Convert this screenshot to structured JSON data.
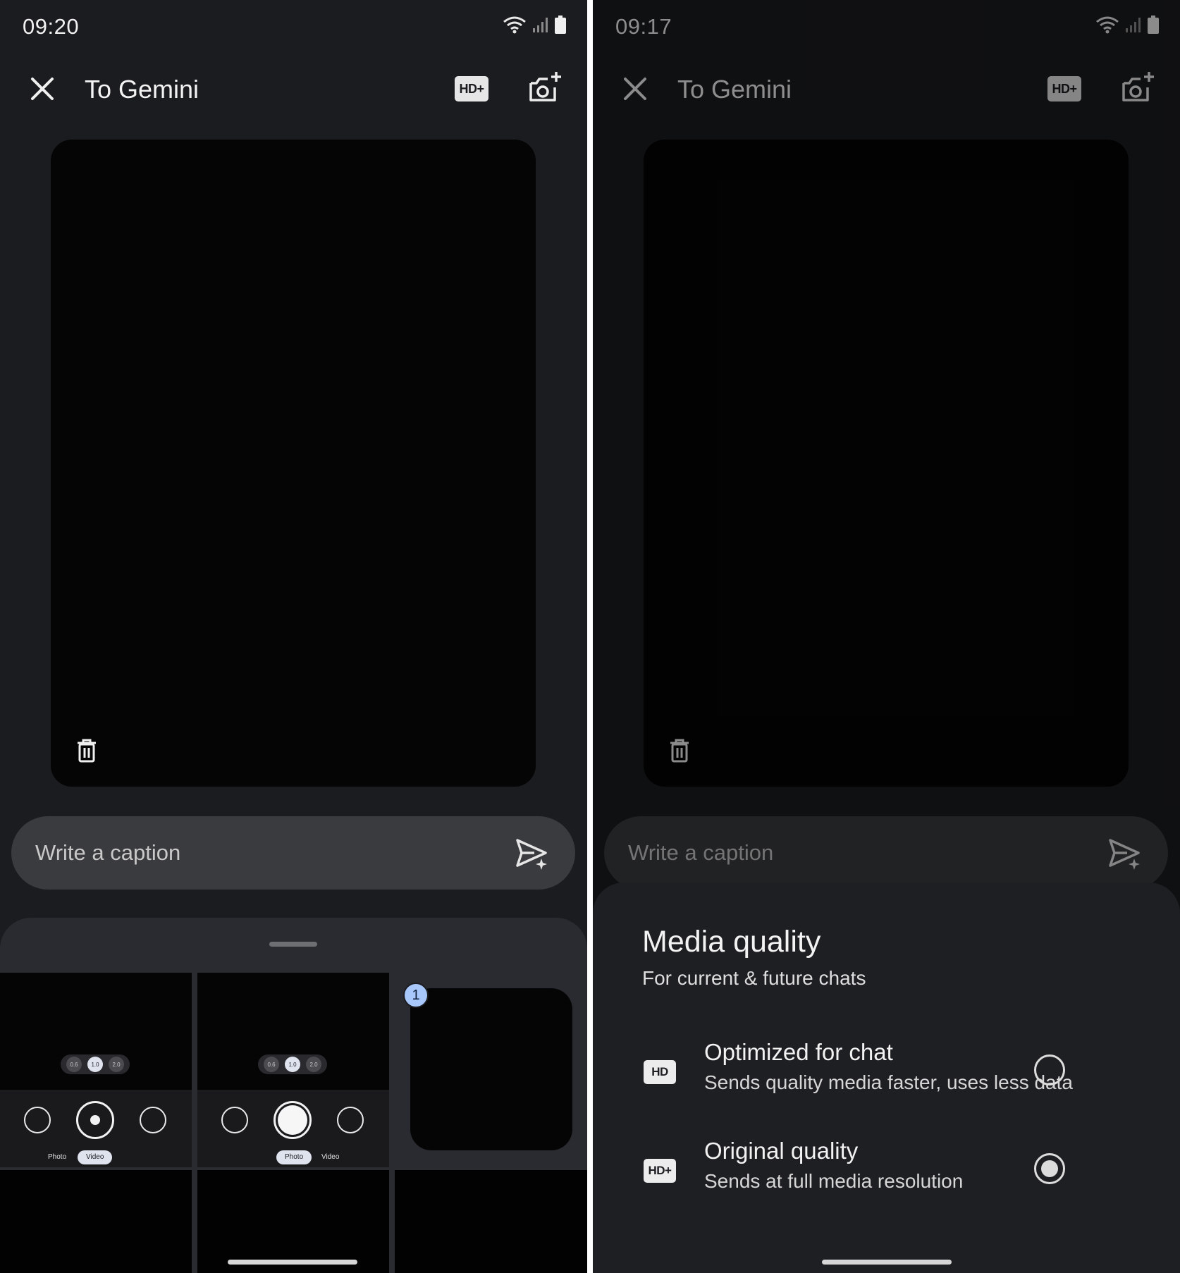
{
  "left_screen": {
    "status": {
      "time": "09:20"
    },
    "topbar": {
      "title": "To Gemini",
      "hd_badge": "HD+"
    },
    "caption": {
      "placeholder": "Write a caption"
    },
    "gallery": {
      "tiles": [
        {
          "zoom": [
            "0.6",
            "1.0",
            "2.0"
          ],
          "modes": [
            "Photo",
            "Video"
          ],
          "active_mode": "Video"
        },
        {
          "zoom": [
            "0.6",
            "1.0",
            "2.0"
          ],
          "modes": [
            "Photo",
            "Video"
          ],
          "active_mode": "Photo"
        }
      ],
      "selected_count": "1"
    }
  },
  "right_screen": {
    "status": {
      "time": "09:17"
    },
    "topbar": {
      "title": "To Gemini",
      "hd_badge": "HD+"
    },
    "caption": {
      "placeholder": "Write a caption"
    },
    "media_quality": {
      "title": "Media quality",
      "subtitle": "For current & future chats",
      "options": [
        {
          "icon": "HD",
          "label": "Optimized for chat",
          "description": "Sends quality media faster, uses less data",
          "selected": false
        },
        {
          "icon": "HD+",
          "label": "Original quality",
          "description": "Sends at full media resolution",
          "selected": true
        }
      ]
    }
  },
  "icons": {
    "close": "close-icon",
    "camera_add": "add-photo-icon",
    "trash": "trash-icon",
    "send": "send-sparkle-icon",
    "wifi": "wifi-icon",
    "signal": "signal-icon",
    "battery": "battery-icon"
  },
  "colors": {
    "background": "#1b1c20",
    "sheet": "#2a2b30",
    "caption_bar": "#3a3b3f",
    "badge": "#a8c7fa"
  }
}
